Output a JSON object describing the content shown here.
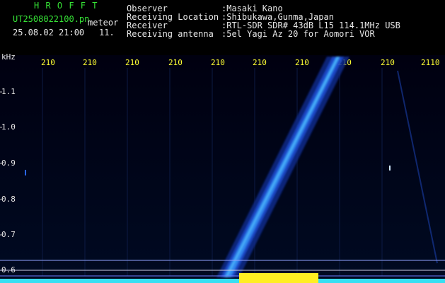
{
  "header": {
    "station": "H R O F F T",
    "filename": "UT2508022100.pn",
    "tag": "meteor",
    "datetime": "25.08.02 21:00",
    "count": "11.",
    "labels": [
      "Observer",
      "Receiving Location",
      "Receiver",
      "Receiving antenna"
    ],
    "values": [
      ":Masaki Kano",
      ":Shibukawa,Gunma,Japan",
      ":RTL-SDR SDR# 43dB L15 114.1MHz USB",
      ":5el Yagi Az 20 for Aomori VOR"
    ]
  },
  "axis": {
    "unit": "kHz",
    "y_ticks": [
      "1.1",
      "1.0",
      "0.9",
      "0.8",
      "0.7",
      "0.6"
    ],
    "x_ticks": [
      "210",
      "210",
      "210",
      "210",
      "210",
      "210",
      "210",
      "210",
      "210",
      "2110"
    ]
  },
  "colors": {
    "background": "#000000",
    "header_green": "#36e336",
    "tick_yellow": "#ffff33",
    "signal_blue": "#2f6bff",
    "signal_cyan": "#33ddff"
  }
}
